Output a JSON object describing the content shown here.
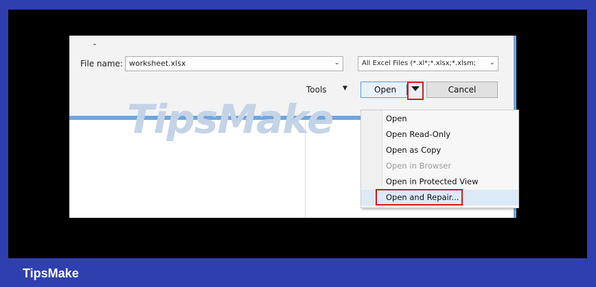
{
  "dialog": {
    "file_name_label": "File name:",
    "file_name_value": "worksheet.xlsx",
    "filter_value": "All Excel Files (*.xl*;*.xlsx;*.xlsm;",
    "tools_label": "Tools",
    "open_label": "Open",
    "cancel_label": "Cancel"
  },
  "open_menu": {
    "items": [
      {
        "label": "Open",
        "enabled": true
      },
      {
        "label": "Open Read-Only",
        "enabled": true
      },
      {
        "label": "Open as Copy",
        "enabled": true
      },
      {
        "label": "Open in Browser",
        "enabled": false
      },
      {
        "label": "Open in Protected View",
        "enabled": true
      },
      {
        "label": "Open and Repair...",
        "enabled": true
      }
    ]
  },
  "watermark": "TipsMake",
  "brand": "TipsMake",
  "icons": {
    "dropdown": "chevron-down-icon",
    "split_arrow": "triangle-down-icon"
  }
}
